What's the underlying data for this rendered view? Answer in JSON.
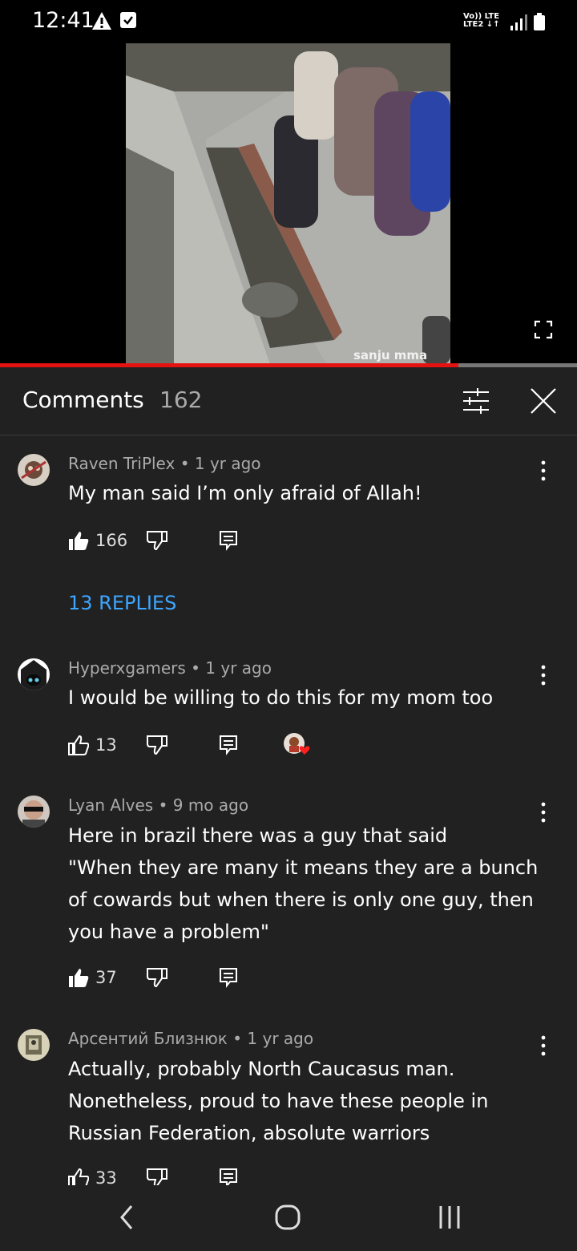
{
  "status_bar": {
    "time": "12:41",
    "network_top": "Vo)) LTE",
    "network_bottom": "LTE2 ↓↑",
    "icons": [
      "warning-icon",
      "check-box-icon",
      "signal-icon",
      "battery-icon"
    ]
  },
  "player": {
    "watermark": "sanju mma",
    "progress_fraction": 0.795,
    "progress_color": "#e51212"
  },
  "comments": {
    "title": "Comments",
    "count": "162",
    "sort_icon": "sort-filter-icon",
    "close_icon": "close-icon",
    "items": [
      {
        "author": "Raven TriPlex",
        "age": "1 yr ago",
        "meta": "Raven TriPlex • 1 yr ago",
        "text": "My man said I’m only afraid of Allah!",
        "likes": "166",
        "liked": true,
        "replies": "13 REPLIES"
      },
      {
        "author": "Hyperxgamers",
        "age": "1 yr ago",
        "meta": "Hyperxgamers • 1 yr ago",
        "text": "I would be willing to do this for my mom too",
        "likes": "13",
        "liked": false,
        "creator_heart": true
      },
      {
        "author": "Lyan Alves",
        "age": "9 mo ago",
        "meta": "Lyan Alves • 9 mo ago",
        "text_lines": [
          "Here in brazil there was a guy that said",
          "\"When they are many it means they are a bunch",
          "of cowards but when there is only one guy, then",
          "you have a problem\""
        ],
        "likes": "37",
        "liked": true
      },
      {
        "author": "Арсентий Близнюк",
        "age": "1 yr ago",
        "meta": "Арсентий Близнюк • 1 yr ago",
        "text_lines": [
          "Actually, probably North Caucasus man.",
          "Nonetheless, proud to have these people in",
          "Russian Federation, absolute warriors"
        ],
        "likes": "33",
        "liked": false
      }
    ]
  },
  "nav_bar": {
    "icons": [
      "back-icon",
      "home-icon",
      "recents-icon"
    ]
  },
  "colors": {
    "background": "#212121",
    "link": "#3ea6ff",
    "meta_text": "#aaaaaa"
  }
}
